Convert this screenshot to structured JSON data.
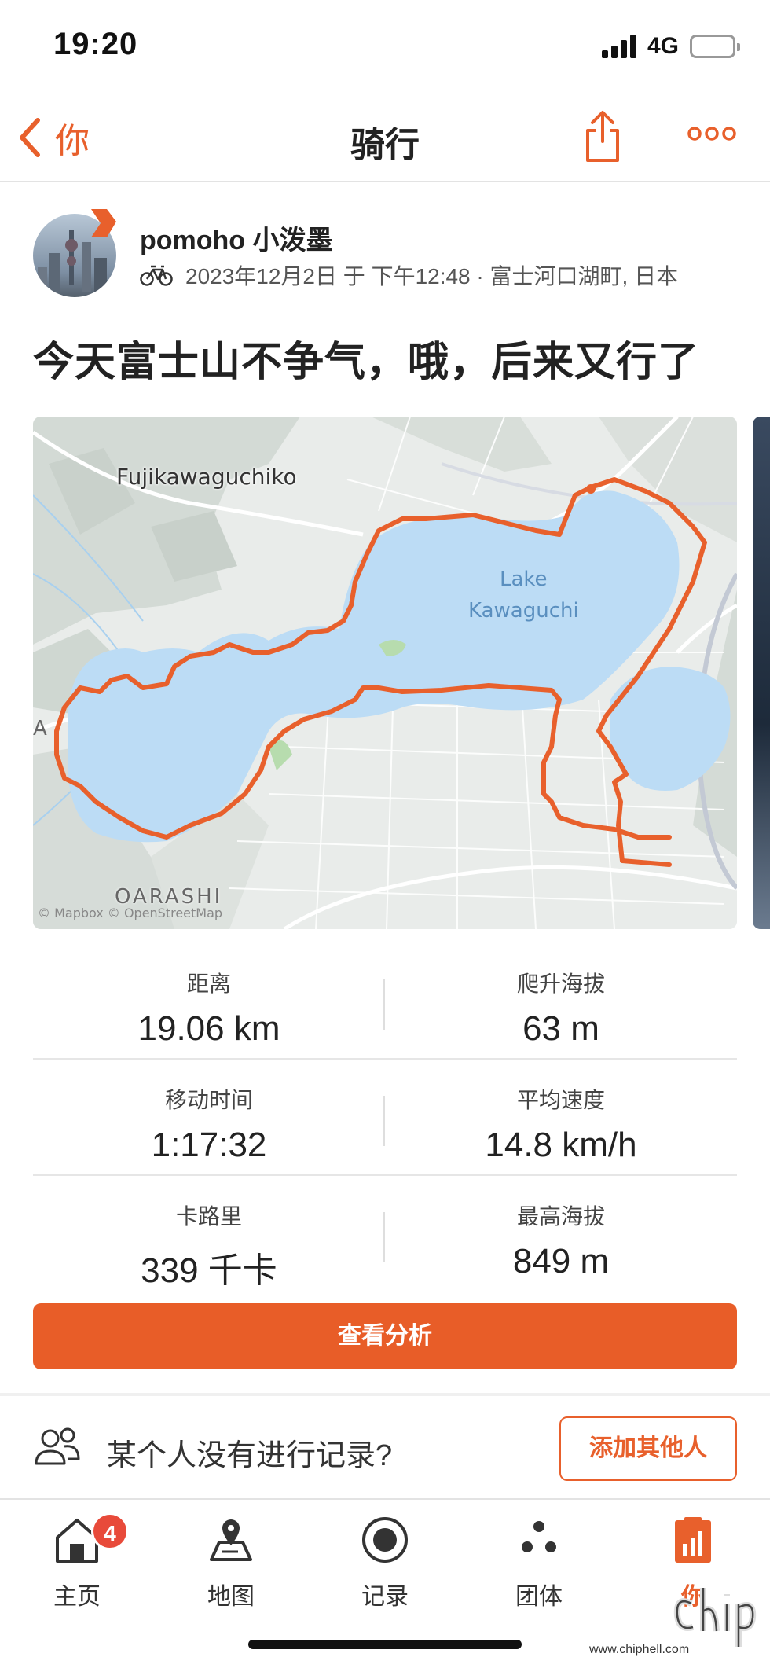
{
  "status": {
    "time": "19:20",
    "network": "4G"
  },
  "nav": {
    "back_label": "你",
    "title": "骑行"
  },
  "activity": {
    "athlete": "pomoho 小泼墨",
    "meta": "2023年12月2日 于 下午12:48 · 富士河口湖町, 日本",
    "title": "今天富士山不争气，哦，后来又行了"
  },
  "map": {
    "town_label": "Fujikawaguchiko",
    "lake_label_1": "Lake",
    "lake_label_2": "Kawaguchi",
    "district_label": "OARASHI",
    "edge_label": "A",
    "attribution": "© Mapbox © OpenStreetMap",
    "route_color": "#e8602c",
    "lake_color": "#bcdcf5"
  },
  "stats": [
    {
      "left": {
        "label": "距离",
        "value": "19.06 km"
      },
      "right": {
        "label": "爬升海拔",
        "value": "63 m"
      }
    },
    {
      "left": {
        "label": "移动时间",
        "value": "1:17:32"
      },
      "right": {
        "label": "平均速度",
        "value": "14.8 km/h"
      }
    },
    {
      "left": {
        "label": "卡路里",
        "value": "339 千卡"
      },
      "right": {
        "label": "最高海拔",
        "value": "849 m"
      }
    }
  ],
  "analysis_button": "查看分析",
  "invite": {
    "text": "某个人没有进行记录?",
    "button": "添加其他人"
  },
  "tabs": [
    {
      "label": "主页",
      "icon": "home-icon",
      "badge": "4"
    },
    {
      "label": "地图",
      "icon": "map-icon"
    },
    {
      "label": "记录",
      "icon": "record-icon"
    },
    {
      "label": "团体",
      "icon": "groups-icon"
    },
    {
      "label": "你",
      "icon": "you-icon"
    }
  ],
  "watermark": {
    "url": "www.chiphell.com"
  },
  "colors": {
    "accent": "#e8602c",
    "button": "#e85d28",
    "badge": "#e84a3a"
  }
}
